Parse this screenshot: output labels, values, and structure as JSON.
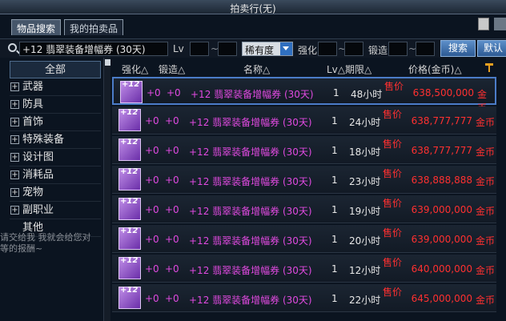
{
  "window": {
    "title": "拍卖行(无)"
  },
  "tabs": [
    {
      "label": "物品搜索",
      "active": true
    },
    {
      "label": "我的拍卖品",
      "active": false
    }
  ],
  "search": {
    "query": "+12 翡翠装备增幅券 (30天)",
    "lv_label": "Lv",
    "rarity_selected": "稀有度",
    "enhance_label": "强化",
    "forge_label": "锻造",
    "search_button": "搜索",
    "default_button": "默认"
  },
  "sidebar": {
    "items": [
      {
        "label": "全部",
        "expandable": false
      },
      {
        "label": "武器",
        "expandable": true
      },
      {
        "label": "防具",
        "expandable": true
      },
      {
        "label": "首饰",
        "expandable": true
      },
      {
        "label": "特殊装备",
        "expandable": true
      },
      {
        "label": "设计图",
        "expandable": true
      },
      {
        "label": "消耗品",
        "expandable": true
      },
      {
        "label": "宠物",
        "expandable": true
      },
      {
        "label": "副职业",
        "expandable": true
      },
      {
        "label": "其他",
        "expandable": false
      }
    ],
    "background_text": "请交给我 我就会给您对等的报酬~"
  },
  "table": {
    "headers": {
      "enhance": "强化△",
      "forge": "锻造△",
      "name": "名称△",
      "lv_duration": "Lv△期限△",
      "price": "价格(金币)△"
    },
    "rows": [
      {
        "icon_text": "+12",
        "enhance": "+0",
        "forge": "+0",
        "name": "+12 翡翠装备增幅券 (30天)",
        "lv": "1",
        "duration": "48小时",
        "sell": "售价",
        "price": "638,500,000",
        "unit": "金币"
      },
      {
        "icon_text": "+12",
        "enhance": "+0",
        "forge": "+0",
        "name": "+12 翡翠装备增幅券 (30天)",
        "lv": "1",
        "duration": "24小时",
        "sell": "售价",
        "price": "638,777,777",
        "unit": "金币"
      },
      {
        "icon_text": "+12",
        "enhance": "+0",
        "forge": "+0",
        "name": "+12 翡翠装备增幅券 (30天)",
        "lv": "1",
        "duration": "18小时",
        "sell": "售价",
        "price": "638,777,777",
        "unit": "金币"
      },
      {
        "icon_text": "+12",
        "enhance": "+0",
        "forge": "+0",
        "name": "+12 翡翠装备增幅券 (30天)",
        "lv": "1",
        "duration": "23小时",
        "sell": "售价",
        "price": "638,888,888",
        "unit": "金币"
      },
      {
        "icon_text": "+12",
        "enhance": "+0",
        "forge": "+0",
        "name": "+12 翡翠装备增幅券 (30天)",
        "lv": "1",
        "duration": "19小时",
        "sell": "售价",
        "price": "639,000,000",
        "unit": "金币"
      },
      {
        "icon_text": "+12",
        "enhance": "+0",
        "forge": "+0",
        "name": "+12 翡翠装备增幅券 (30天)",
        "lv": "1",
        "duration": "20小时",
        "sell": "售价",
        "price": "639,000,000",
        "unit": "金币"
      },
      {
        "icon_text": "+12",
        "enhance": "+0",
        "forge": "+0",
        "name": "+12 翡翠装备增幅券 (30天)",
        "lv": "1",
        "duration": "12小时",
        "sell": "售价",
        "price": "640,000,000",
        "unit": "金币"
      },
      {
        "icon_text": "+12",
        "enhance": "+0",
        "forge": "+0",
        "name": "+12 翡翠装备增幅券 (30天)",
        "lv": "1",
        "duration": "22小时",
        "sell": "售价",
        "price": "645,000,000",
        "unit": "金币"
      }
    ]
  }
}
